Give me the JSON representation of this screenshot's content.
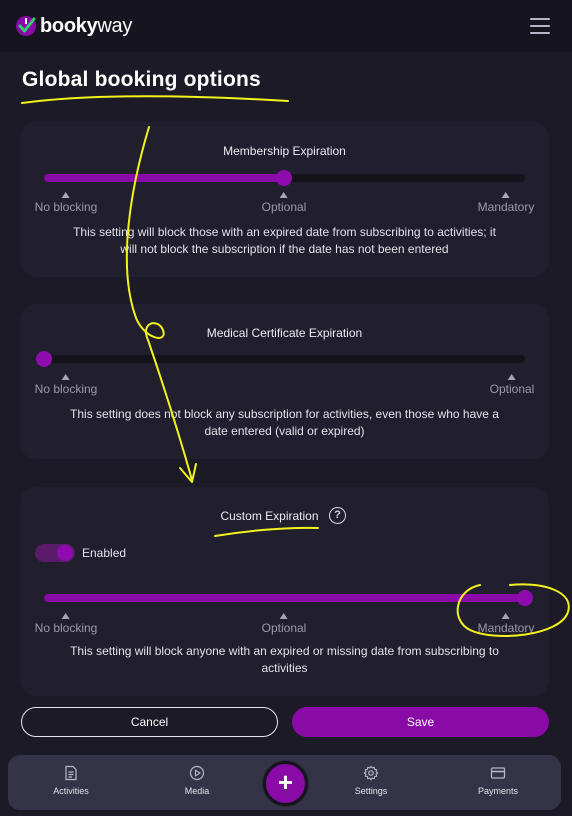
{
  "header": {
    "logo_bold": "booky",
    "logo_light": "way",
    "menu_icon": "hamburger-menu-icon"
  },
  "page": {
    "title": "Global booking options"
  },
  "cards": [
    {
      "title": "Membership Expiration",
      "slider_value_fraction": 0.5,
      "ticks": [
        "No blocking",
        "Optional",
        "Mandatory"
      ],
      "selected": "Optional",
      "description_line1": "This setting will block those with an expired date from subscribing to activities; it",
      "description_line2": "will not block the subscription if the date has not been entered"
    },
    {
      "title": "Medical Certificate Expiration",
      "slider_value_fraction": 0.0,
      "ticks": [
        "No blocking",
        "Optional"
      ],
      "selected": "No blocking",
      "description_line1": "This setting does not block any subscription for activities, even those who have a",
      "description_line2": "date entered (valid or expired)"
    },
    {
      "title": "Custom Expiration",
      "help_icon": "question-mark-icon",
      "help_glyph": "?",
      "toggle_label": "Enabled",
      "toggle_on": true,
      "slider_value_fraction": 1.0,
      "ticks": [
        "No blocking",
        "Optional",
        "Mandatory"
      ],
      "selected": "Mandatory",
      "description_line1": "This setting will block anyone with an expired or missing date from subscribing to",
      "description_line2": "activities"
    }
  ],
  "actions": {
    "cancel_label": "Cancel",
    "save_label": "Save"
  },
  "bottom_nav": {
    "items": [
      {
        "label": "Activities",
        "icon": "document-icon"
      },
      {
        "label": "Media",
        "icon": "play-circle-icon"
      },
      {
        "label": "Settings",
        "icon": "gear-icon"
      },
      {
        "label": "Payments",
        "icon": "credit-card-icon"
      }
    ],
    "fab_glyph": "+",
    "fab_icon": "plus-icon"
  },
  "colors": {
    "accent": "#8a0aa8",
    "background": "#1b1a26",
    "card": "#211f2d",
    "annotation": "#f4f21c"
  }
}
